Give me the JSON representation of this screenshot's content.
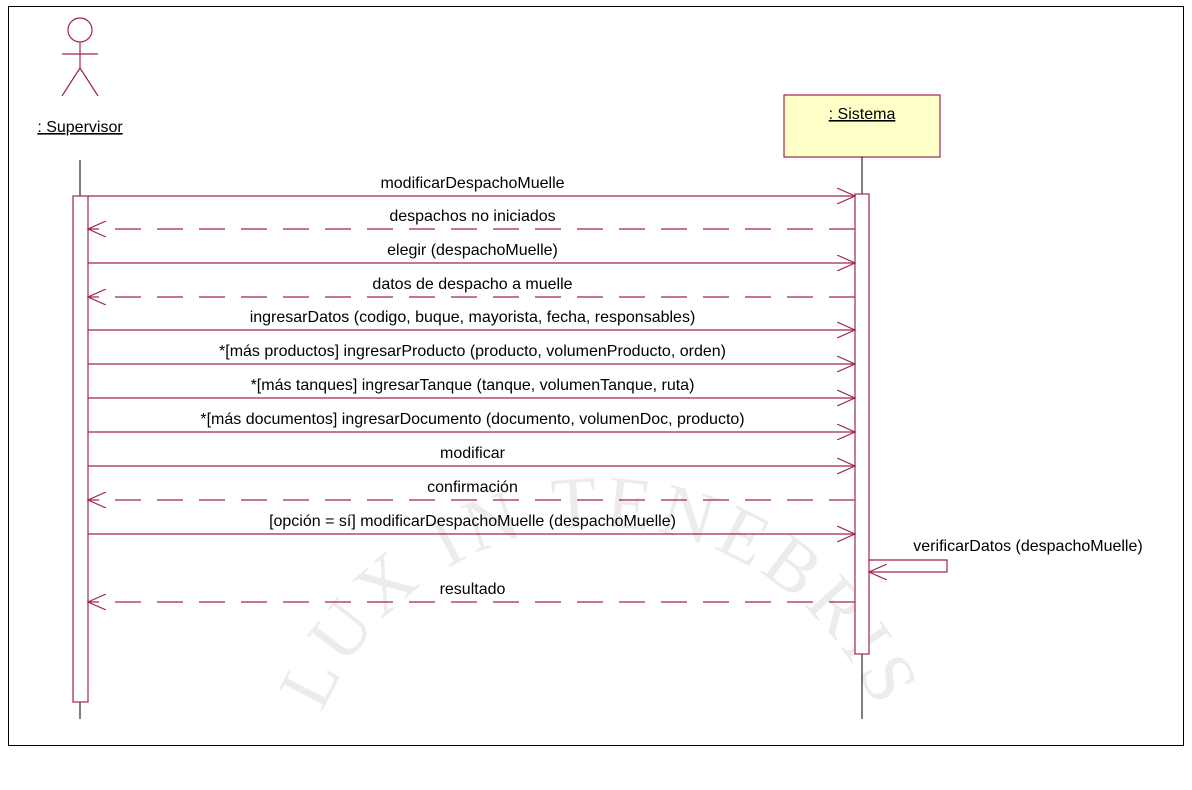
{
  "actor": {
    "name": ": Supervisor"
  },
  "system": {
    "name": ": Sistema"
  },
  "colors": {
    "line": "#a0264c",
    "object_fill": "#ffffc8",
    "stroke": "#000000"
  },
  "messages": [
    {
      "label": "modificarDespachoMuelle",
      "kind": "call"
    },
    {
      "label": "despachos no iniciados",
      "kind": "return"
    },
    {
      "label": "elegir (despachoMuelle)",
      "kind": "call"
    },
    {
      "label": "datos de despacho a muelle",
      "kind": "return"
    },
    {
      "label": "ingresarDatos (codigo, buque, mayorista, fecha, responsables)",
      "kind": "call"
    },
    {
      "label": "*[más productos] ingresarProducto (producto, volumenProducto, orden)",
      "kind": "call"
    },
    {
      "label": "*[más tanques] ingresarTanque (tanque, volumenTanque, ruta)",
      "kind": "call"
    },
    {
      "label": "*[más documentos] ingresarDocumento (documento, volumenDoc, producto)",
      "kind": "call"
    },
    {
      "label": "modificar",
      "kind": "call"
    },
    {
      "label": "confirmación",
      "kind": "return"
    },
    {
      "label": "[opción = sí] modificarDespachoMuelle (despachoMuelle)",
      "kind": "call"
    },
    {
      "label": "verificarDatos (despachoMuelle)",
      "kind": "self"
    },
    {
      "label": "resultado",
      "kind": "return"
    }
  ],
  "watermark": {
    "text": "LUX IN TENEBRIS"
  }
}
